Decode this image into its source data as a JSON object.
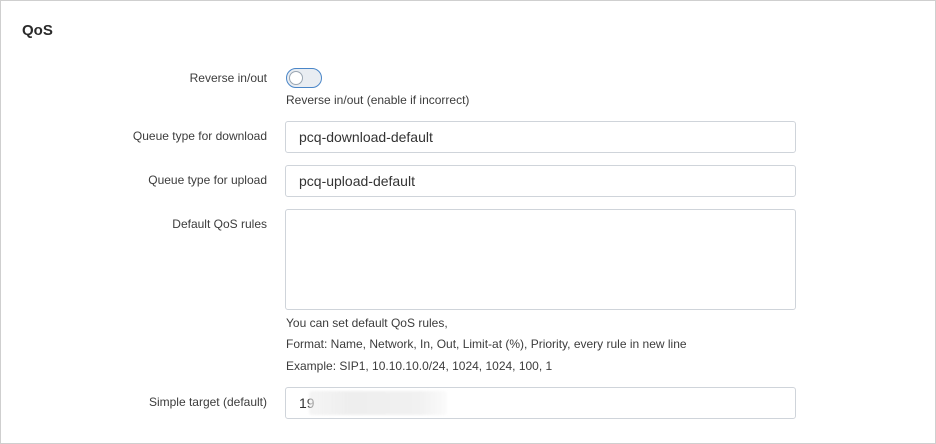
{
  "section": {
    "title": "QoS"
  },
  "reverse": {
    "label": "Reverse in/out",
    "enabled": false,
    "help": "Reverse in/out (enable if incorrect)"
  },
  "queue_download": {
    "label": "Queue type for download",
    "value": "pcq-download-default"
  },
  "queue_upload": {
    "label": "Queue type for upload",
    "value": "pcq-upload-default"
  },
  "default_rules": {
    "label": "Default QoS rules",
    "value": "",
    "help_line1": "You can set default QoS rules,",
    "help_line2": "Format: Name, Network, In, Out, Limit-at (%), Priority, every rule in new line",
    "help_line3": "Example: SIP1, 10.10.10.0/24, 1024, 1024, 100, 1"
  },
  "simple_target": {
    "label": "Simple target (default)",
    "value": "19"
  }
}
